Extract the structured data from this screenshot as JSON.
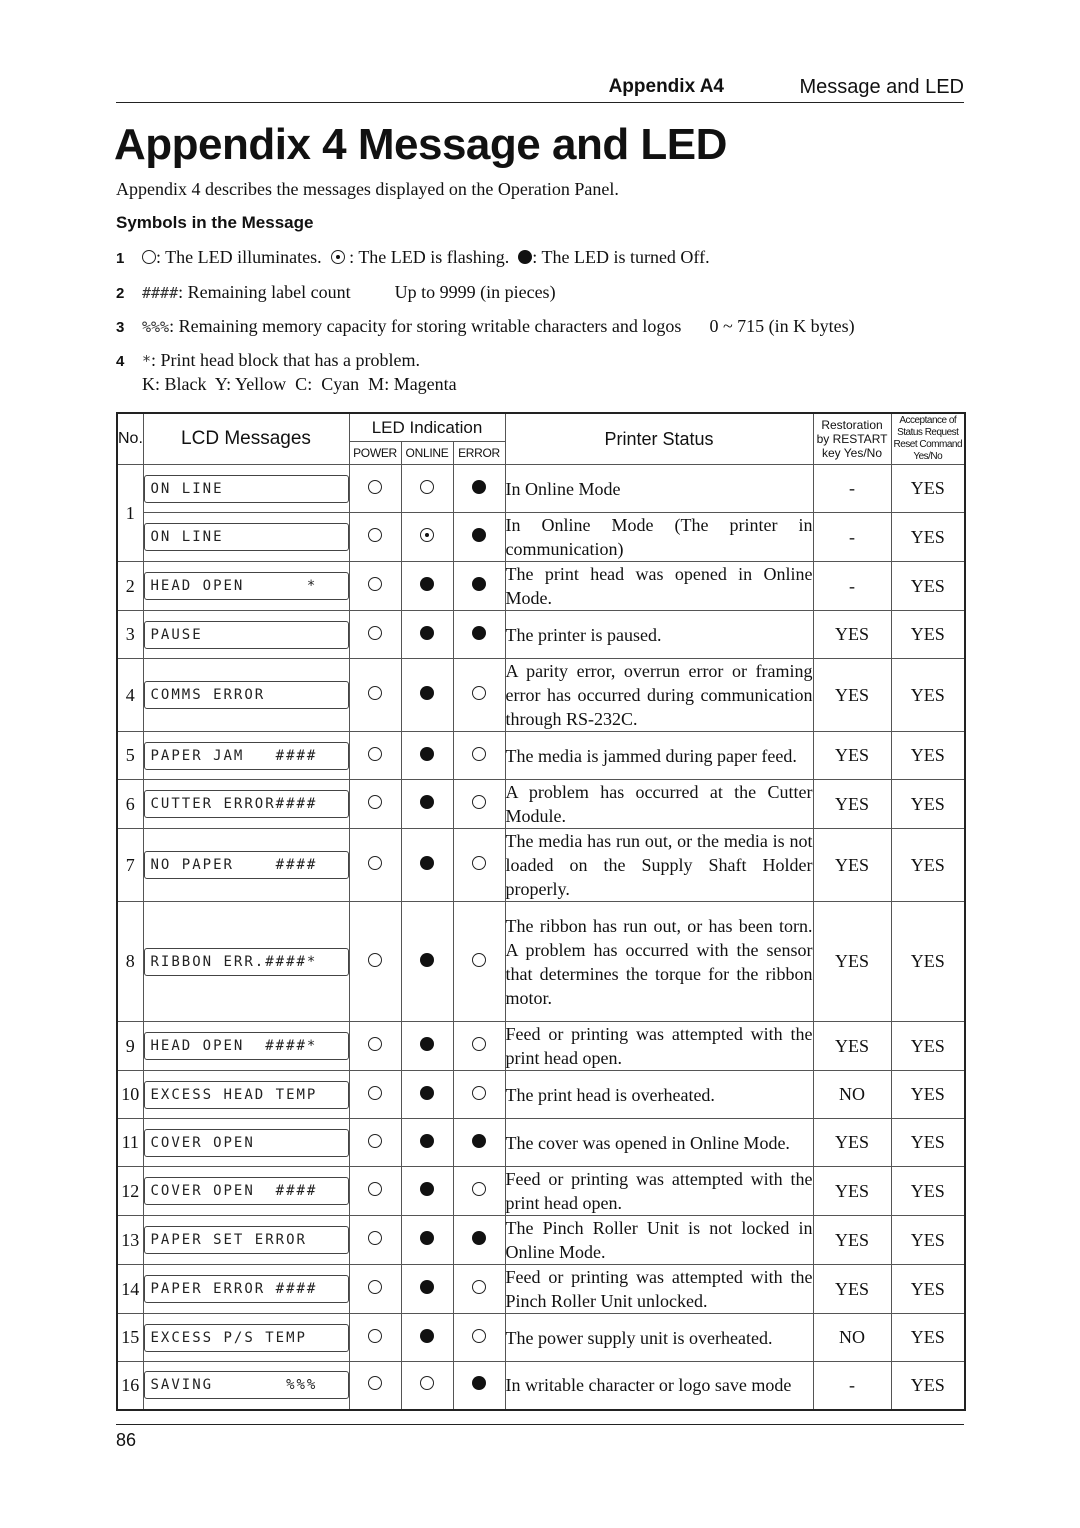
{
  "header": {
    "appendix": "Appendix A4",
    "section": "Message and LED"
  },
  "title": "Appendix 4 Message and LED",
  "intro": "Appendix 4 describes the messages displayed on the Operation Panel.",
  "symbols": {
    "heading": "Symbols in the Message",
    "items": [
      {
        "num": "1",
        "led_on": ": The LED illuminates.",
        "led_flash": ": The LED is flashing.",
        "led_off": ": The LED is turned Off."
      },
      {
        "num": "2",
        "symbol": "####",
        "text": ": Remaining label count",
        "range": "Up to 9999 (in pieces)"
      },
      {
        "num": "3",
        "symbol": "%%%",
        "text": ": Remaining memory capacity for storing writable characters and logos",
        "range": "0 ~ 715 (in K bytes)"
      },
      {
        "num": "4",
        "symbol": "*",
        "text": ": Print head block that has a problem.",
        "line2": "K: Black  Y: Yellow  C:  Cyan  M: Magenta"
      }
    ]
  },
  "table": {
    "headers": {
      "no": "No.",
      "lcd": "LCD Messages",
      "led": "LED Indication",
      "power": "POWER",
      "online": "ONLINE",
      "error": "ERROR",
      "status": "Printer Status",
      "restoration": "Restoration by RESTART key Yes/No",
      "acceptance": "Acceptance of Status Request Reset Command Yes/No"
    },
    "rows": [
      {
        "no": "1",
        "lcd": "ON LINE",
        "power": "on",
        "online": "on",
        "error": "off",
        "status": "In Online Mode",
        "restoration": "-",
        "acceptance": "YES"
      },
      {
        "no": "",
        "lcd": "ON LINE",
        "power": "on",
        "online": "flash",
        "error": "off",
        "status": "In Online Mode (The printer in communication)",
        "restoration": "-",
        "acceptance": "YES"
      },
      {
        "no": "2",
        "lcd": "HEAD OPEN      *",
        "power": "on",
        "online": "off",
        "error": "off",
        "status": "The print head was opened in Online Mode.",
        "restoration": "-",
        "acceptance": "YES"
      },
      {
        "no": "3",
        "lcd": "PAUSE",
        "power": "on",
        "online": "off",
        "error": "off",
        "status": "The printer is paused.",
        "restoration": "YES",
        "acceptance": "YES"
      },
      {
        "no": "4",
        "lcd": "COMMS ERROR",
        "power": "on",
        "online": "off",
        "error": "on",
        "status": "A parity error, overrun error or framing error has occurred during communication through RS-232C.",
        "restoration": "YES",
        "acceptance": "YES"
      },
      {
        "no": "5",
        "lcd": "PAPER JAM   ####",
        "power": "on",
        "online": "off",
        "error": "on",
        "status": "The media is jammed during paper feed.",
        "restoration": "YES",
        "acceptance": "YES"
      },
      {
        "no": "6",
        "lcd": "CUTTER ERROR####",
        "power": "on",
        "online": "off",
        "error": "on",
        "status": "A problem has occurred at the Cutter Module.",
        "restoration": "YES",
        "acceptance": "YES"
      },
      {
        "no": "7",
        "lcd": "NO PAPER    ####",
        "power": "on",
        "online": "off",
        "error": "on",
        "status": "The media has run out, or the media is not loaded on the Supply Shaft Holder properly.",
        "restoration": "YES",
        "acceptance": "YES"
      },
      {
        "no": "8",
        "lcd": "RIBBON ERR.####*",
        "power": "on",
        "online": "off",
        "error": "on",
        "status": "The ribbon has run out, or has been torn. A problem has occurred with the sensor that determines the torque for the ribbon motor.",
        "restoration": "YES",
        "acceptance": "YES"
      },
      {
        "no": "9",
        "lcd": "HEAD OPEN  ####*",
        "power": "on",
        "online": "off",
        "error": "on",
        "status": "Feed or printing was attempted with the print head open.",
        "restoration": "YES",
        "acceptance": "YES"
      },
      {
        "no": "10",
        "lcd": "EXCESS HEAD TEMP",
        "power": "on",
        "online": "off",
        "error": "on",
        "status": "The print head is overheated.",
        "restoration": "NO",
        "acceptance": "YES"
      },
      {
        "no": "11",
        "lcd": "COVER OPEN",
        "power": "on",
        "online": "off",
        "error": "off",
        "status": "The cover was opened in Online Mode.",
        "restoration": "YES",
        "acceptance": "YES"
      },
      {
        "no": "12",
        "lcd": "COVER OPEN  ####",
        "power": "on",
        "online": "off",
        "error": "on",
        "status": "Feed or printing was attempted with the print head open.",
        "restoration": "YES",
        "acceptance": "YES"
      },
      {
        "no": "13",
        "lcd": "PAPER SET ERROR",
        "power": "on",
        "online": "off",
        "error": "off",
        "status": "The Pinch Roller Unit is not locked in Online Mode.",
        "restoration": "YES",
        "acceptance": "YES"
      },
      {
        "no": "14",
        "lcd": "PAPER ERROR ####",
        "power": "on",
        "online": "off",
        "error": "on",
        "status": "Feed or printing was attempted with the Pinch Roller Unit unlocked.",
        "restoration": "YES",
        "acceptance": "YES"
      },
      {
        "no": "15",
        "lcd": "EXCESS P/S TEMP",
        "power": "on",
        "online": "off",
        "error": "on",
        "status": "The power supply unit is overheated.",
        "restoration": "NO",
        "acceptance": "YES"
      },
      {
        "no": "16",
        "lcd": "SAVING       %%%",
        "power": "on",
        "online": "on",
        "error": "off",
        "status": "In writable character or logo save mode",
        "restoration": "-",
        "acceptance": "YES"
      }
    ]
  },
  "footer": {
    "page_number": "86"
  }
}
